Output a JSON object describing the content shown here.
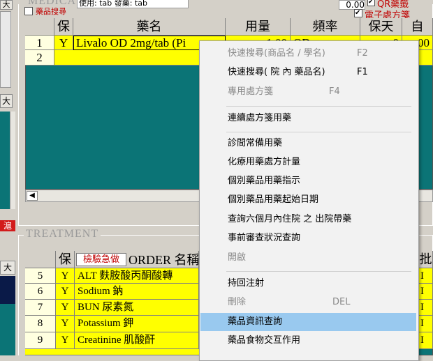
{
  "left": {
    "top_button": "大",
    "mid_button": "大",
    "red_tag": "滬",
    "bottom_button": "大"
  },
  "medication": {
    "title": "MEDICA",
    "search_checkbox_label": "藥品搜尋",
    "usage_label": "使用: tab 發藥: tab",
    "dose_value": "0.00",
    "qr_label": "QR藥籤",
    "eprescription_label": "電子處方箋",
    "headers": {
      "insurance": "保",
      "drug_name": "藥名",
      "dosage": "用量",
      "frequency": "頻率",
      "days": "保天",
      "self": "自"
    },
    "rows": [
      {
        "num": "1",
        "ins": "Y",
        "drug": "Livalo OD 2mg/tab (Pi",
        "dosage": "1.00",
        "freq": "QD",
        "days": "0",
        "self": "00"
      },
      {
        "num": "2",
        "ins": "",
        "drug": "",
        "dosage": "",
        "freq": "",
        "days": "",
        "self": ""
      }
    ]
  },
  "treatment": {
    "title": "TREATMENT",
    "headers": {
      "insurance": "保",
      "urgent_button": "檢驗急做",
      "order_name": "ORDER 名稱"
    },
    "rows": [
      {
        "num": "5",
        "ins": "Y",
        "name": "ALT 麩胺酸丙酮酸轉"
      },
      {
        "num": "6",
        "ins": "Y",
        "name": "Sodium 鈉"
      },
      {
        "num": "7",
        "ins": "Y",
        "name": "BUN 尿素氮"
      },
      {
        "num": "8",
        "ins": "Y",
        "name": "Potassium 鉀"
      },
      {
        "num": "9",
        "ins": "Y",
        "name": "Creatinine 肌酸酐"
      }
    ],
    "right_col_header": "批"
  },
  "context_menu": {
    "items": [
      {
        "label": "快速搜尋(商品名 / 學名)",
        "key": "F2"
      },
      {
        "label": "快速搜尋( 院 內 藥品名)",
        "key": "F1"
      },
      {
        "label": "專用處方箋",
        "key": "F4"
      },
      {
        "label": "連續處方箋用藥",
        "key": ""
      },
      {
        "label": "診間常備用藥",
        "key": ""
      },
      {
        "label": "化療用藥處方計量",
        "key": ""
      },
      {
        "label": "個別藥品用藥指示",
        "key": ""
      },
      {
        "label": "個別藥品用藥起始日期",
        "key": ""
      },
      {
        "label": "查詢六個月內住院 之 出院帶藥",
        "key": ""
      },
      {
        "label": "事前審查狀況查詢",
        "key": ""
      },
      {
        "label": "開啟",
        "key": ""
      },
      {
        "label": "持回注射",
        "key": ""
      },
      {
        "label": "刪除",
        "key": "DEL"
      },
      {
        "label": "藥品資訊查詢",
        "key": ""
      },
      {
        "label": "藥品食物交互作用",
        "key": ""
      }
    ]
  }
}
